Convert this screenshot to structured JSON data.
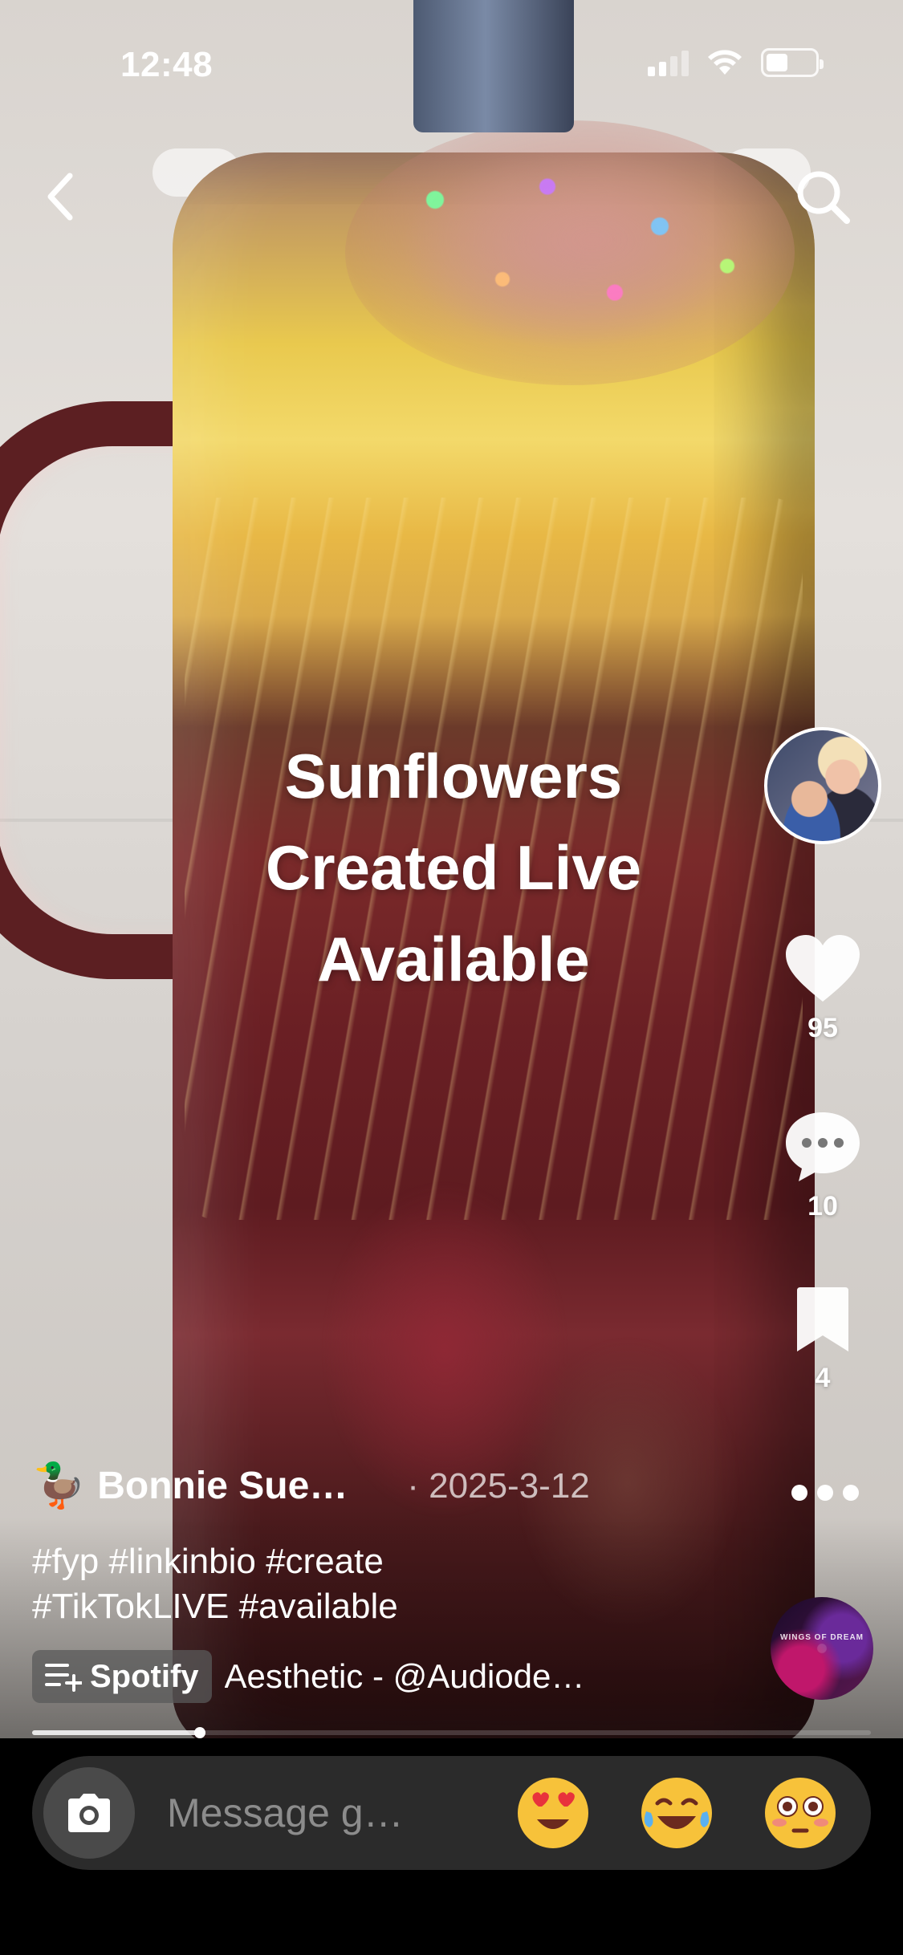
{
  "status_bar": {
    "time": "12:48",
    "battery_level": 0.45
  },
  "overlay_caption": {
    "lines": [
      "Sunflowers",
      "Created Live",
      "Available"
    ]
  },
  "actions": {
    "likes": "95",
    "comments": "10",
    "saves": "4"
  },
  "post": {
    "author": "Bonnie Sue…",
    "date": "· 2025-3-12",
    "hashtags": [
      "#fyp #linkinbio #create",
      "#TikTokLIVE #available"
    ]
  },
  "music": {
    "source_label": "Spotify",
    "title": "Aesthetic - @Audiode…",
    "disc_label": "WINGS OF DREAM"
  },
  "playback": {
    "progress": 0.2
  },
  "message_bar": {
    "placeholder": "Message g…",
    "quick_emojis": [
      "😍",
      "😂",
      "😳"
    ]
  },
  "icons": {
    "back": "chevron-left-icon",
    "search": "search-icon",
    "like": "heart-icon",
    "comment": "comment-bubble-icon",
    "save": "bookmark-icon",
    "more": "ellipsis-icon",
    "playlist": "playlist-add-icon",
    "camera": "camera-icon"
  }
}
